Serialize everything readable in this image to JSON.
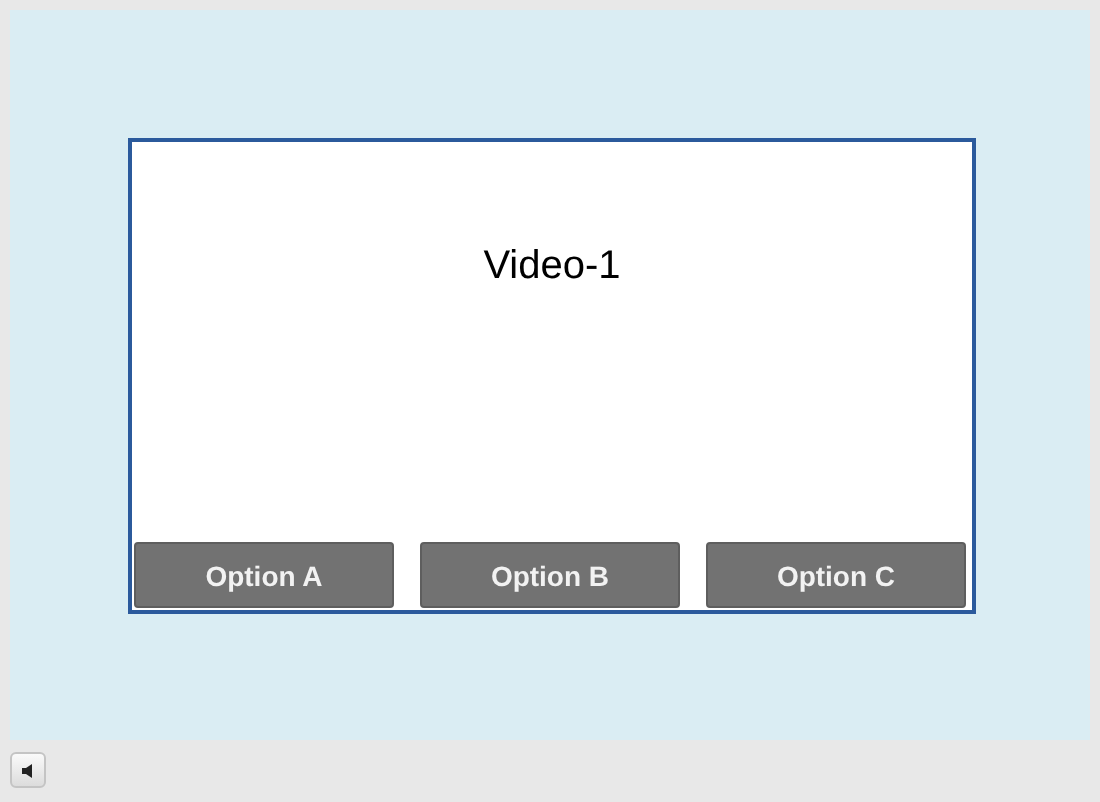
{
  "slide": {
    "title": "Video-1",
    "options": [
      {
        "label": "Option A"
      },
      {
        "label": "Option B"
      },
      {
        "label": "Option C"
      }
    ]
  }
}
